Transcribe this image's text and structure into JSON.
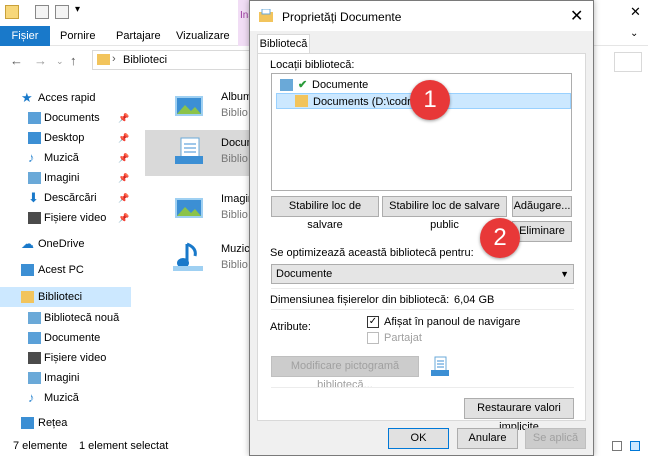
{
  "explorer": {
    "ribbon_tabs": [
      "Fișier",
      "Pornire",
      "Partajare",
      "Vizualizare"
    ],
    "manage_tab": "Ins",
    "address": "Biblioteci",
    "nav": [
      {
        "label": "Acces rapid",
        "pinned": false
      },
      {
        "label": "Documents",
        "pinned": true
      },
      {
        "label": "Desktop",
        "pinned": true
      },
      {
        "label": "Muzică",
        "pinned": true
      },
      {
        "label": "Imagini",
        "pinned": true
      },
      {
        "label": "Descărcări",
        "pinned": true
      },
      {
        "label": "Fișiere video",
        "pinned": true
      },
      {
        "label": "OneDrive",
        "pinned": false
      },
      {
        "label": "Acest PC",
        "pinned": false
      },
      {
        "label": "Biblioteci",
        "pinned": false
      },
      {
        "label": "Bibliotecă nouă",
        "pinned": false
      },
      {
        "label": "Documente",
        "pinned": false
      },
      {
        "label": "Fișiere video",
        "pinned": false
      },
      {
        "label": "Imagini",
        "pinned": false
      },
      {
        "label": "Muzică",
        "pinned": false
      },
      {
        "label": "Rețea",
        "pinned": false
      }
    ],
    "libraries": [
      {
        "name": "Album",
        "sub": "Biblio"
      },
      {
        "name": "Docum",
        "sub": "Biblio"
      },
      {
        "name": "Imagin",
        "sub": "Biblio"
      },
      {
        "name": "Muzică",
        "sub": "Biblio"
      }
    ],
    "status_count": "7 elemente",
    "status_selected": "1 element selectat"
  },
  "dialog": {
    "title": "Proprietăți Documente",
    "tab": "Bibliotecă",
    "locations_label": "Locații bibliotecă:",
    "locations": [
      {
        "label": "Documente"
      },
      {
        "label": "Documents (D:\\codru)"
      }
    ],
    "btn_set_save": "Stabilire loc de salvare",
    "btn_set_public": "Stabilire loc de salvare public",
    "btn_add": "Adăugare...",
    "btn_remove": "Eliminare",
    "optimize_label": "Se optimizează această bibliotecă pentru:",
    "optimize_value": "Documente",
    "size_label": "Dimensiunea fișierelor din bibliotecă:",
    "size_value": "6,04 GB",
    "attributes_label": "Atribute:",
    "attr_nav": "Afișat în panoul de navigare",
    "attr_shared": "Partajat",
    "btn_change_icon": "Modificare pictogramă bibliotecă...",
    "btn_restore": "Restaurare valori implicite",
    "btn_ok": "OK",
    "btn_cancel": "Anulare",
    "btn_apply": "Se aplică"
  },
  "badges": [
    "1",
    "2"
  ],
  "colors": {
    "accent": "#1979ca",
    "badge": "#e83838",
    "selection": "#cce8ff"
  }
}
